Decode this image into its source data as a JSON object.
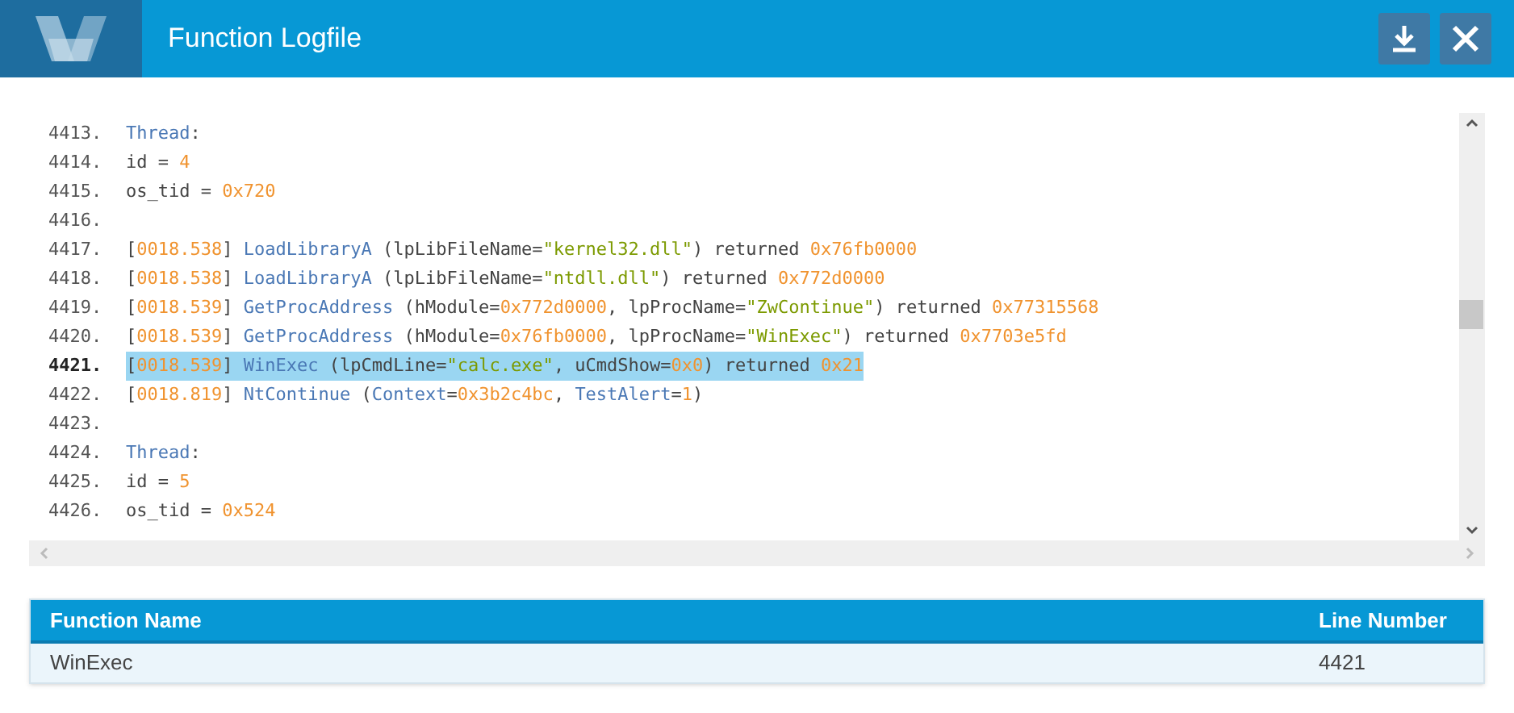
{
  "window": {
    "title": "Function Logfile"
  },
  "log": {
    "lines": [
      {
        "number": "4413.",
        "selected": false,
        "tokens": [
          {
            "kind": "name",
            "text": "Thread"
          },
          {
            "kind": "plain",
            "text": ":"
          }
        ]
      },
      {
        "number": "4414.",
        "selected": false,
        "tokens": [
          {
            "kind": "plain",
            "text": "id = "
          },
          {
            "kind": "num",
            "text": "4"
          }
        ]
      },
      {
        "number": "4415.",
        "selected": false,
        "tokens": [
          {
            "kind": "plain",
            "text": "os_tid = "
          },
          {
            "kind": "num",
            "text": "0x720"
          }
        ]
      },
      {
        "number": "4416.",
        "selected": false
      },
      {
        "number": "4417.",
        "selected": false,
        "tokens": [
          {
            "kind": "plain",
            "text": "["
          },
          {
            "kind": "num",
            "text": "0018.538"
          },
          {
            "kind": "plain",
            "text": "] "
          },
          {
            "kind": "name",
            "text": "LoadLibraryA"
          },
          {
            "kind": "plain",
            "text": " (lpLibFileName="
          },
          {
            "kind": "str",
            "text": "\"kernel32.dll\""
          },
          {
            "kind": "plain",
            "text": ") returned "
          },
          {
            "kind": "num",
            "text": "0x76fb0000"
          }
        ]
      },
      {
        "number": "4418.",
        "selected": false,
        "tokens": [
          {
            "kind": "plain",
            "text": "["
          },
          {
            "kind": "num",
            "text": "0018.538"
          },
          {
            "kind": "plain",
            "text": "] "
          },
          {
            "kind": "name",
            "text": "LoadLibraryA"
          },
          {
            "kind": "plain",
            "text": " (lpLibFileName="
          },
          {
            "kind": "str",
            "text": "\"ntdll.dll\""
          },
          {
            "kind": "plain",
            "text": ") returned "
          },
          {
            "kind": "num",
            "text": "0x772d0000"
          }
        ]
      },
      {
        "number": "4419.",
        "selected": false,
        "tokens": [
          {
            "kind": "plain",
            "text": "["
          },
          {
            "kind": "num",
            "text": "0018.539"
          },
          {
            "kind": "plain",
            "text": "] "
          },
          {
            "kind": "name",
            "text": "GetProcAddress"
          },
          {
            "kind": "plain",
            "text": " (hModule="
          },
          {
            "kind": "num",
            "text": "0x772d0000"
          },
          {
            "kind": "plain",
            "text": ", lpProcName="
          },
          {
            "kind": "str",
            "text": "\"ZwContinue\""
          },
          {
            "kind": "plain",
            "text": ") returned "
          },
          {
            "kind": "num",
            "text": "0x77315568"
          }
        ]
      },
      {
        "number": "4420.",
        "selected": false,
        "tokens": [
          {
            "kind": "plain",
            "text": "["
          },
          {
            "kind": "num",
            "text": "0018.539"
          },
          {
            "kind": "plain",
            "text": "] "
          },
          {
            "kind": "name",
            "text": "GetProcAddress"
          },
          {
            "kind": "plain",
            "text": " (hModule="
          },
          {
            "kind": "num",
            "text": "0x76fb0000"
          },
          {
            "kind": "plain",
            "text": ", lpProcName="
          },
          {
            "kind": "str",
            "text": "\"WinExec\""
          },
          {
            "kind": "plain",
            "text": ") returned "
          },
          {
            "kind": "num",
            "text": "0x7703e5fd"
          }
        ]
      },
      {
        "number": "4421.",
        "selected": true,
        "tokens": [
          {
            "kind": "plain",
            "text": "["
          },
          {
            "kind": "num",
            "text": "0018.539"
          },
          {
            "kind": "plain",
            "text": "] "
          },
          {
            "kind": "name",
            "text": "WinExec"
          },
          {
            "kind": "plain",
            "text": " (lpCmdLine="
          },
          {
            "kind": "str",
            "text": "\"calc.exe\""
          },
          {
            "kind": "plain",
            "text": ", uCmdShow="
          },
          {
            "kind": "num",
            "text": "0x0"
          },
          {
            "kind": "plain",
            "text": ") returned "
          },
          {
            "kind": "num",
            "text": "0x21"
          }
        ]
      },
      {
        "number": "4422.",
        "selected": false,
        "tokens": [
          {
            "kind": "plain",
            "text": "["
          },
          {
            "kind": "num",
            "text": "0018.819"
          },
          {
            "kind": "plain",
            "text": "] "
          },
          {
            "kind": "name",
            "text": "NtContinue"
          },
          {
            "kind": "plain",
            "text": " ("
          },
          {
            "kind": "name",
            "text": "Context"
          },
          {
            "kind": "plain",
            "text": "="
          },
          {
            "kind": "num",
            "text": "0x3b2c4bc"
          },
          {
            "kind": "plain",
            "text": ", "
          },
          {
            "kind": "name",
            "text": "TestAlert"
          },
          {
            "kind": "plain",
            "text": "="
          },
          {
            "kind": "num",
            "text": "1"
          },
          {
            "kind": "plain",
            "text": ")"
          }
        ]
      },
      {
        "number": "4423.",
        "selected": false
      },
      {
        "number": "4424.",
        "selected": false,
        "tokens": [
          {
            "kind": "name",
            "text": "Thread"
          },
          {
            "kind": "plain",
            "text": ":"
          }
        ]
      },
      {
        "number": "4425.",
        "selected": false,
        "tokens": [
          {
            "kind": "plain",
            "text": "id = "
          },
          {
            "kind": "num",
            "text": "5"
          }
        ]
      },
      {
        "number": "4426.",
        "selected": false,
        "tokens": [
          {
            "kind": "plain",
            "text": "os_tid = "
          },
          {
            "kind": "num",
            "text": "0x524"
          }
        ]
      }
    ]
  },
  "table": {
    "columns": [
      "Function Name",
      "Line Number"
    ],
    "rows": [
      [
        "WinExec",
        "4421"
      ]
    ]
  }
}
